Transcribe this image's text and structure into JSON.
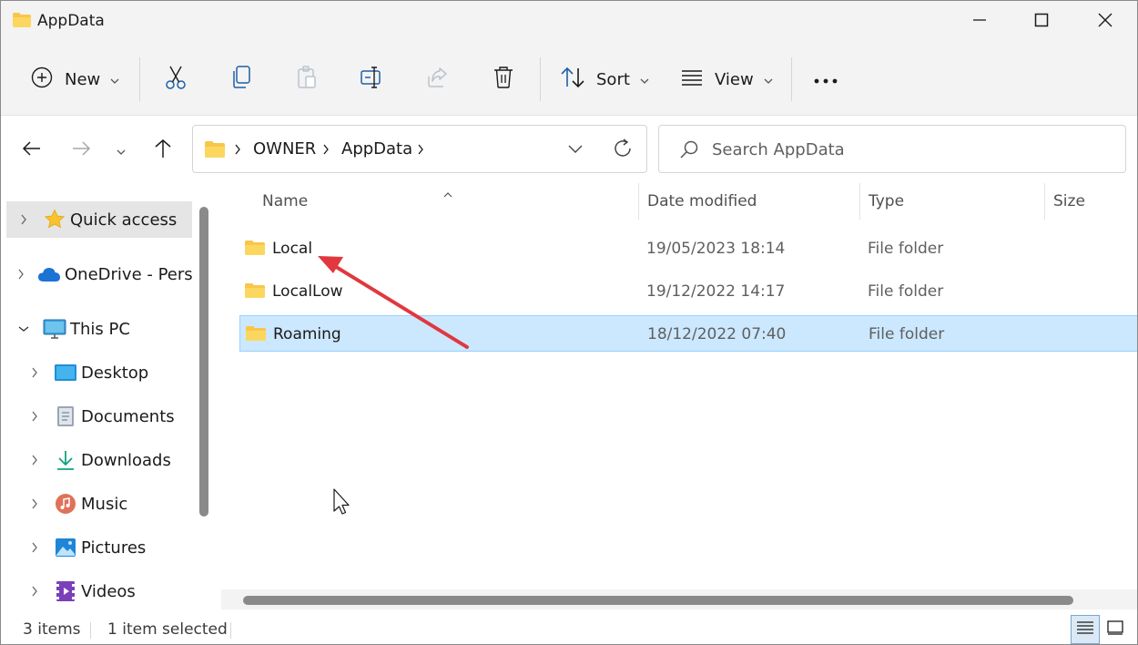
{
  "window": {
    "title": "AppData",
    "title_icon": "folder-icon"
  },
  "window_controls": {
    "minimize": "minimize-icon",
    "maximize": "maximize-icon",
    "close": "close-icon"
  },
  "toolbar": {
    "new_label": "New",
    "sort_label": "Sort",
    "view_label": "View",
    "icons": [
      "add-icon",
      "cut-icon",
      "copy-icon",
      "paste-icon",
      "rename-icon",
      "share-icon",
      "delete-icon",
      "sort-icon",
      "view-icon",
      "more-icon"
    ]
  },
  "address": {
    "breadcrumbs": [
      "OWNER",
      "AppData"
    ]
  },
  "search": {
    "placeholder": "Search AppData"
  },
  "sidebar": {
    "items": [
      {
        "label": "Quick access",
        "icon": "star-icon",
        "selected": true
      },
      {
        "label": "OneDrive - Perso",
        "icon": "cloud-icon"
      },
      {
        "label": "This PC",
        "icon": "monitor-icon",
        "expanded": true
      },
      {
        "label": "Desktop",
        "icon": "desktop-icon"
      },
      {
        "label": "Documents",
        "icon": "documents-icon"
      },
      {
        "label": "Downloads",
        "icon": "download-icon"
      },
      {
        "label": "Music",
        "icon": "music-icon"
      },
      {
        "label": "Pictures",
        "icon": "pictures-icon"
      },
      {
        "label": "Videos",
        "icon": "videos-icon"
      }
    ]
  },
  "table": {
    "columns": [
      "Name",
      "Date modified",
      "Type",
      "Size"
    ],
    "rows": [
      {
        "name": "Local",
        "date": "19/05/2023 18:14",
        "type": "File folder",
        "selected": false
      },
      {
        "name": "LocalLow",
        "date": "19/12/2022 14:17",
        "type": "File folder",
        "selected": false
      },
      {
        "name": "Roaming",
        "date": "18/12/2022 07:40",
        "type": "File folder",
        "selected": true
      }
    ]
  },
  "status": {
    "item_count": "3 items",
    "selection": "1 item selected"
  },
  "colors": {
    "accent": "#0067c0",
    "selection_bg": "#cce8ff",
    "annotation_arrow": "#e0383e",
    "folder": "#f8c64a"
  }
}
